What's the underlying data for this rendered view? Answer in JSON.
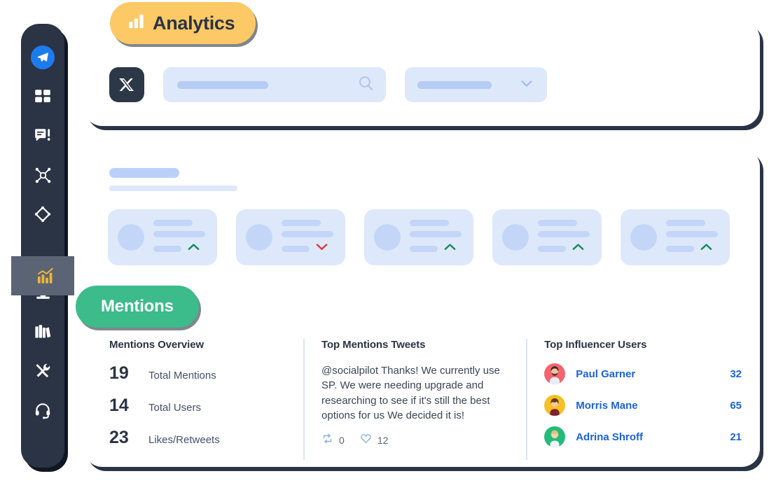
{
  "badges": {
    "analytics": {
      "label": "Analytics",
      "icon": "bar-chart-icon",
      "color": "#fcc966"
    },
    "mentions": {
      "label": "Mentions",
      "color": "#3cbb8b"
    }
  },
  "sidebar": {
    "background": "#2b3445",
    "active_background": "#5a6474",
    "items": [
      {
        "icon": "paper-plane-icon",
        "name": "compose",
        "active": false
      },
      {
        "icon": "grid-dashboard-icon",
        "name": "dashboard",
        "active": false
      },
      {
        "icon": "chat-alert-icon",
        "name": "inbox-messages",
        "active": false
      },
      {
        "icon": "network-share-icon",
        "name": "connections",
        "active": false
      },
      {
        "icon": "diamond-icon",
        "name": "discovery",
        "active": false
      },
      {
        "icon": "analytics-chart-icon",
        "name": "analytics",
        "active": true
      },
      {
        "icon": "download-tray-icon",
        "name": "downloads",
        "active": false
      },
      {
        "icon": "books-library-icon",
        "name": "content-library",
        "active": false
      },
      {
        "icon": "tools-icon",
        "name": "tools",
        "active": false
      },
      {
        "icon": "headset-icon",
        "name": "support",
        "active": false
      }
    ]
  },
  "filter_bar": {
    "network_icon": "x-twitter-logo",
    "search": {
      "placeholder": "",
      "value": "",
      "icon": "search-icon"
    },
    "dropdown": {
      "value": "",
      "icon": "chevron-down-icon"
    }
  },
  "stat_cards": [
    {
      "trend": "up",
      "trend_color": "#1b8a5a"
    },
    {
      "trend": "down",
      "trend_color": "#e03c3c"
    },
    {
      "trend": "up",
      "trend_color": "#1b8a5a"
    },
    {
      "trend": "up",
      "trend_color": "#1b8a5a"
    },
    {
      "trend": "up",
      "trend_color": "#1b8a5a"
    }
  ],
  "overview": {
    "title": "Mentions Overview",
    "rows": [
      {
        "value": "19",
        "label": "Total Mentions"
      },
      {
        "value": "14",
        "label": "Total Users"
      },
      {
        "value": "23",
        "label": "Likes/Retweets"
      }
    ]
  },
  "top_tweets": {
    "title": "Top Mentions Tweets",
    "text": "@socialpilot Thanks! We currently use SP. We were needing upgrade and researching to see if it's still the best options for us We decided it is!",
    "retweets": "0",
    "likes": "12",
    "retweet_icon": "retweet-icon",
    "like_icon": "heart-icon"
  },
  "influencers": {
    "title": "Top Influencer Users",
    "users": [
      {
        "name": "Paul Garner",
        "count": "32",
        "avatar_color": "#f4646f"
      },
      {
        "name": "Morris Mane",
        "count": "65",
        "avatar_color": "#f6c026"
      },
      {
        "name": "Adrina Shroff",
        "count": "21",
        "avatar_color": "#22bb7a"
      }
    ]
  }
}
